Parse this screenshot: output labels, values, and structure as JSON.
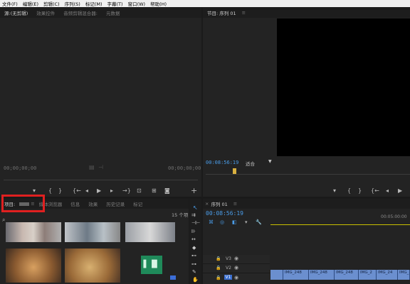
{
  "menu": [
    "文件(F)",
    "编辑(E)",
    "剪辑(C)",
    "序列(S)",
    "标记(M)",
    "字幕(T)",
    "窗口(W)",
    "帮助(H)"
  ],
  "source_panel": {
    "tabs": [
      "源:(无剪辑)",
      "效果控件",
      "音频剪辑混合器:",
      "元数据"
    ],
    "timecode_left": "00;00;00;00",
    "timecode_right": "00;00;00;00"
  },
  "program_panel": {
    "tab": "节目: 序列 01",
    "timecode": "00:08:56:19",
    "fit_label": "适合"
  },
  "project_panel": {
    "tabs": [
      "项目:",
      "媒体浏览器",
      "信息",
      "效果",
      "历史记录",
      "标记"
    ],
    "item_count": "15 个项",
    "highlight_color": "#e02020"
  },
  "timeline": {
    "tab": "序列 01",
    "timecode": "00:08:56:19",
    "ruler_label": "00:05:00:00",
    "tracks": [
      {
        "name": "V3"
      },
      {
        "name": "V2"
      },
      {
        "name": "V1"
      }
    ],
    "clips": [
      "IMG_248",
      "IMG_248",
      "IMG_248",
      "IMG_2",
      "IMG_24",
      "IMG_2"
    ],
    "clip_color": "#6b8fcf"
  },
  "icons": {
    "play": "play-icon",
    "add": "plus-icon",
    "wrench": "wrench-icon",
    "audio": "audio-waveform-icon"
  }
}
